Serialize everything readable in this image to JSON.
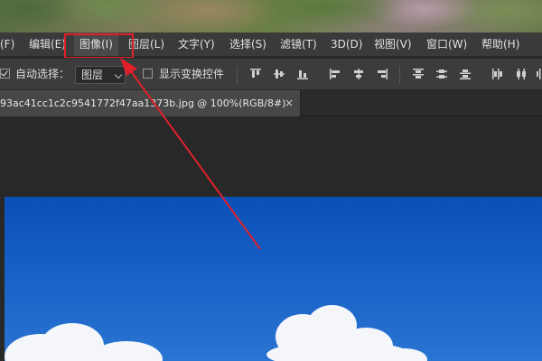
{
  "menubar": {
    "items": [
      {
        "label": "(F)"
      },
      {
        "label": "编辑(E)"
      },
      {
        "label": "图像(I)"
      },
      {
        "label": "图层(L)"
      },
      {
        "label": "文字(Y)"
      },
      {
        "label": "选择(S)"
      },
      {
        "label": "滤镜(T)"
      },
      {
        "label": "3D(D)"
      },
      {
        "label": "视图(V)"
      },
      {
        "label": "窗口(W)"
      },
      {
        "label": "帮助(H)"
      }
    ],
    "highlighted_item": "图像(I)"
  },
  "options": {
    "auto_select_label": "自动选择：",
    "auto_select_checked": true,
    "auto_select_value": "图层",
    "show_transform_label": "显示变换控件",
    "show_transform_checked": false
  },
  "document": {
    "tab_title": "93ac41cc1c2c9541772f47aa1373b.jpg @ 100%(RGB/8#)",
    "close_symbol": "×"
  },
  "colors": {
    "annotation": "#e0202a",
    "sky": "#1760c6",
    "panel": "#3a3a3a"
  }
}
